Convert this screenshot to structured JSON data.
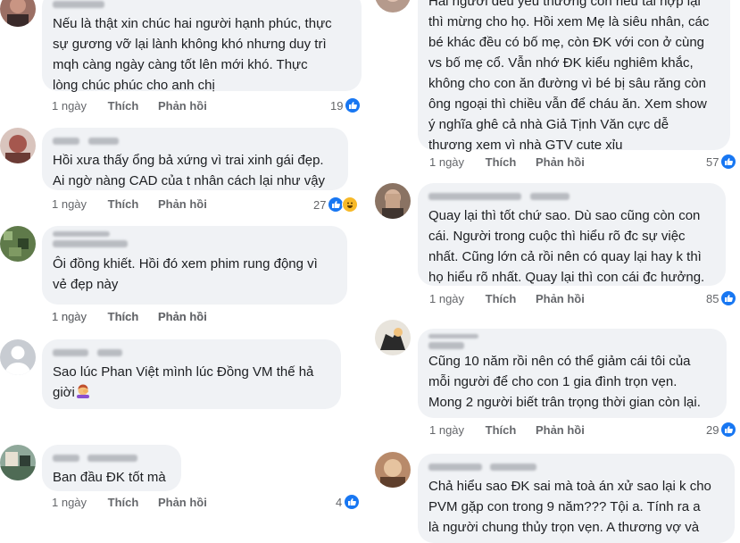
{
  "labels": {
    "like": "Thích",
    "reply": "Phản hồi"
  },
  "colors": {
    "bubble": "#f0f2f5",
    "meta": "#65676b",
    "like_blue": "#1877f2",
    "haha_yellow": "#f7b928"
  },
  "left_comments": [
    {
      "author": "Lê Thị Vy",
      "text": "Nếu là thật xin chúc hai người hạnh phúc, thực\nsự gương vỡ lại lành không khó nhưng duy trì\nmqh càng ngày càng tốt lên mới khó. Thực\nlòng chúc phúc cho anh chị",
      "time": "1 ngày",
      "reaction_count": "19",
      "reactions": [
        "like-icon"
      ]
    },
    {
      "author": "Trần Hằng",
      "text": "Hồi xưa thấy ổng bả xứng vì trai xinh gái đẹp.\nAi ngờ nàng CAD của t nhân cách lại như vậy",
      "time": "1 ngày",
      "reaction_count": "27",
      "reactions": [
        "like-icon",
        "haha-icon"
      ]
    },
    {
      "author": "Nguyễn Minh",
      "text": "Ôi đồng khiết. Hồi đó xem phim rung động vì\nvẻ đẹp này",
      "time": "1 ngày",
      "reaction_count": "",
      "reactions": []
    },
    {
      "author": "Huyền Trần",
      "text": "Sao lúc Phan Việt mình lúc Đồng VM thế hả\ngiời",
      "time": "1 ngày",
      "reaction_count": "",
      "reactions": [],
      "inline_emoji": "woman-facepalming-icon"
    },
    {
      "author": "Minh Thùy Vân",
      "text": "Ban đầu ĐK tốt mà",
      "time": "1 ngày",
      "reaction_count": "4",
      "reactions": [
        "like-icon"
      ]
    }
  ],
  "right_comments": [
    {
      "author": "",
      "text": "Hai người đều yêu thương con nếu tái hợp lại\nthì mừng cho họ. Hồi xem Mẹ là siêu nhân, các\nbé khác đều có bố mẹ, còn ĐK với con ở cùng\nvs bố mẹ cổ. Vẫn nhớ ĐK kiểu nghiêm khắc,\nkhông cho con ăn đường vì bé bị sâu răng còn\nông ngoại thì chiều vẫn để cháu ăn. Xem show\ný nghĩa ghê cả nhà Giả Tịnh Văn cực dễ\nthương xem vì nhà GTV cute xỉu",
      "time": "1 ngày",
      "reaction_count": "57",
      "reactions": [
        "like-icon"
      ]
    },
    {
      "author": "Lương Thu Trang",
      "text": "Quay lại thì tốt chứ sao. Dù sao cũng còn con\ncái. Người trong cuộc thì hiểu rõ đc sự việc\nnhất. Cũng lớn cả rồi nên có quay lại hay k thì\nhọ hiểu rõ nhất. Quay lại thì con cái đc hưởng.",
      "time": "1 ngày",
      "reaction_count": "85",
      "reactions": [
        "like-icon"
      ]
    },
    {
      "author": "Vương Anh",
      "text": "Cũng 10 năm rồi nên có thể giảm cái tôi của\nmỗi người để cho con 1 gia đình trọn vẹn.\nMong 2 người biết trân trọng thời gian còn lại.",
      "time": "1 ngày",
      "reaction_count": "29",
      "reactions": [
        "like-icon"
      ]
    },
    {
      "author": "Trần Hoàng Nam",
      "text": "Chả hiểu sao ĐK sai mà toà án xử sao lại k cho\nPVM gặp con trong 9 năm??? Tội a. Tính ra a\nlà người chung thủy trọn vẹn. A thương vợ và",
      "time": "",
      "reaction_count": "",
      "reactions": []
    }
  ]
}
